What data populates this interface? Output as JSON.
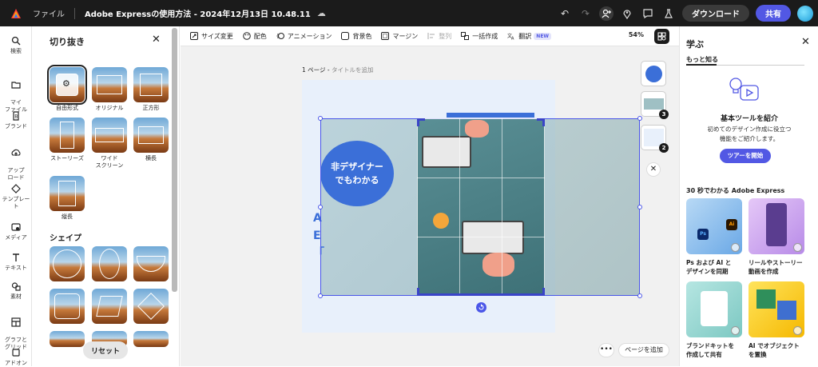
{
  "topbar": {
    "file_label": "ファイル",
    "doc_title": "Adobe Expressの使用方法 - 2024年12月13日 10.48.11",
    "download_label": "ダウンロード",
    "share_label": "共有"
  },
  "rail": {
    "items": [
      {
        "label": "検索",
        "icon": "search-icon"
      },
      {
        "label": "マイ\nファイル",
        "icon": "folder-icon"
      },
      {
        "label": "ブランド",
        "icon": "brand-icon"
      },
      {
        "label": "アップ\nロード",
        "icon": "upload-icon"
      },
      {
        "label": "テンプレート",
        "icon": "template-icon"
      },
      {
        "label": "メディア",
        "icon": "media-icon"
      },
      {
        "label": "テキスト",
        "icon": "text-icon"
      },
      {
        "label": "素材",
        "icon": "elements-icon"
      },
      {
        "label": "グラフと\nグリッド",
        "icon": "grid-icon"
      },
      {
        "label": "アドオン",
        "icon": "addon-icon"
      }
    ]
  },
  "crop_panel": {
    "title": "切り抜き",
    "presets": [
      {
        "label": "自由形式"
      },
      {
        "label": "オリジナル"
      },
      {
        "label": "正方形"
      },
      {
        "label": "ストーリーズ"
      },
      {
        "label": "ワイド\nスクリーン"
      },
      {
        "label": "横長"
      },
      {
        "label": "縦長"
      }
    ],
    "shape_title": "シェイプ",
    "reset_label": "リセット"
  },
  "toolbar": {
    "tools": [
      {
        "label": "サイズ変更",
        "icon": "resize-icon",
        "disabled": false
      },
      {
        "label": "配色",
        "icon": "palette-icon",
        "disabled": false
      },
      {
        "label": "アニメーション",
        "icon": "animation-icon",
        "disabled": false
      },
      {
        "label": "背景色",
        "icon": "background-icon",
        "disabled": false
      },
      {
        "label": "マージン",
        "icon": "margin-icon",
        "disabled": false
      },
      {
        "label": "整列",
        "icon": "align-icon",
        "disabled": true
      },
      {
        "label": "一括作成",
        "icon": "bulk-icon",
        "disabled": false
      },
      {
        "label": "翻訳",
        "icon": "translate-icon",
        "disabled": false
      }
    ],
    "new_badge": "NEW",
    "zoom": "54%"
  },
  "canvas": {
    "page_label": "1 ページ - ",
    "page_title_placeholder": "タイトルを追加",
    "bubble_line1": "非デザイナー",
    "bubble_line2": "でもわかる",
    "side_letters": "A\nE\n「",
    "page_thumbs": [
      {
        "num": ""
      },
      {
        "num": "3"
      },
      {
        "num": "2"
      }
    ],
    "add_page_label": "ページを追加",
    "more_label": "•••"
  },
  "learn_panel": {
    "title": "学ぶ",
    "tab": "もっと知る",
    "heading": "基本ツールを紹介",
    "desc_line1": "初めてのデザイン作成に役立つ",
    "desc_line2": "機能をご紹介します。",
    "tour_button": "ツアーを開始",
    "section": "30 秒でわかる Adobe Express",
    "cards": [
      {
        "label": "Ps および AI と\nデザインを同期"
      },
      {
        "label": "リールやストーリー\n動画を作成"
      },
      {
        "label": "ブランドキットを\n作成して共有"
      },
      {
        "label": "AI でオブジェクト\nを置換"
      }
    ]
  },
  "colors": {
    "accent": "#5258e4",
    "topbar": "#1b1b1b",
    "selection": "#4a56e8",
    "bubble": "#3b6fd8"
  }
}
